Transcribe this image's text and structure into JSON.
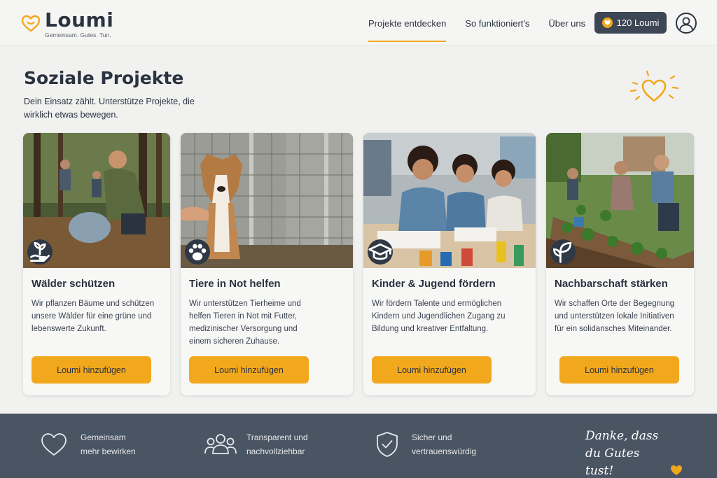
{
  "brand": {
    "name": "Loumi",
    "tagline": "Gemeinsam. Gutes. Tun."
  },
  "nav": {
    "items": [
      {
        "label": "Projekte entdecken",
        "active": true
      },
      {
        "label": "So funktioniert's",
        "active": false
      },
      {
        "label": "Über uns",
        "active": false
      }
    ]
  },
  "balance": {
    "label": "120 Loumi"
  },
  "hero": {
    "title": "Soziale Projekte",
    "subtitle": "Dein Einsatz zählt. Unterstütze Projekte, die wirklich etwas bewegen."
  },
  "projects": [
    {
      "title": "Wälder schützen",
      "description": "Wir pflanzen Bäume und schützen unsere Wälder für eine grüne und lebenswerte Zukunft.",
      "button": "Loumi hinzufügen",
      "icon": "seedling-hand-icon"
    },
    {
      "title": "Tiere in Not helfen",
      "description": "Wir unterstützen Tierheime und helfen Tieren in Not mit Futter, medizinischer Versorgung und einem sicheren Zuhause.",
      "button": "Loumi hinzufügen",
      "icon": "paw-icon"
    },
    {
      "title": "Kinder & Jugend fördern",
      "description": "Wir fördern Talente und ermöglichen Kindern und Jugendlichen Zugang zu Bildung und kreativer Entfaltung.",
      "button": "Loumi hinzufügen",
      "icon": "graduation-cap-icon"
    },
    {
      "title": "Nachbarschaft stärken",
      "description": "Wir schaffen Orte der Begegnung und unterstützen lokale Initiativen für ein solidarisches Miteinander.",
      "button": "Loumi hinzufügen",
      "icon": "sprout-icon"
    }
  ],
  "footer": {
    "features": [
      {
        "text": "Gemeinsam mehr bewirken",
        "icon": "heart-outline-icon"
      },
      {
        "text": "Transparent und nachvollziehbar",
        "icon": "people-group-icon"
      },
      {
        "text": "Sicher und vertrauenswürdig",
        "icon": "shield-check-icon"
      }
    ],
    "thanks": "Danke, dass du Gutes tust!"
  },
  "colors": {
    "accent": "#f2a81d",
    "dark": "#2b3340",
    "footer": "#4a5563",
    "background": "#f1f1f0"
  }
}
